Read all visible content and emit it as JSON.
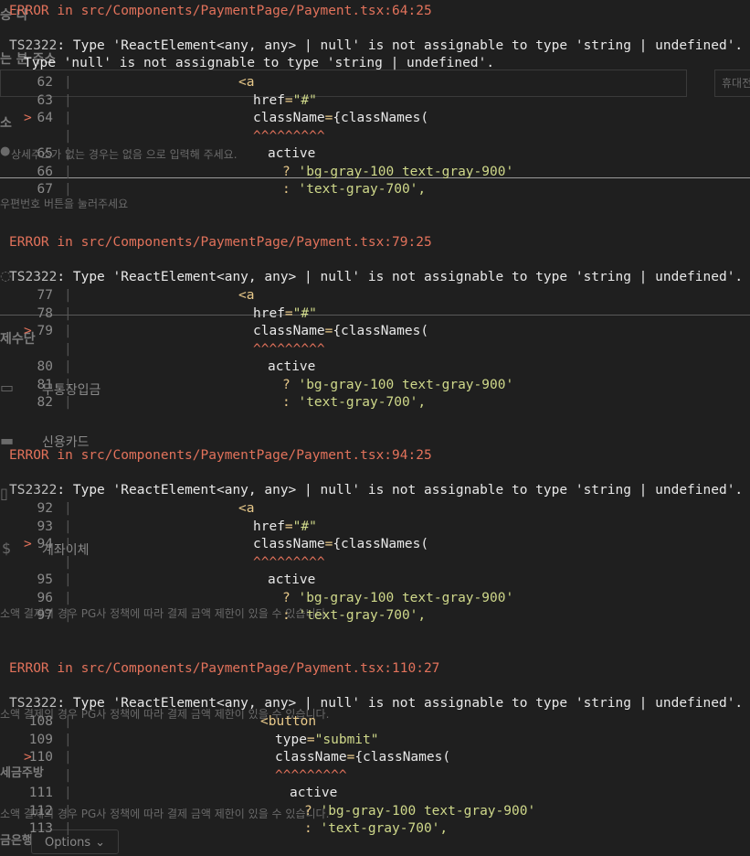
{
  "underlay": {
    "t1": "승 다",
    "t2": "는 분 주소",
    "t3": "소",
    "t4": "상세주소가 없는 경우는 없음 으로 입력해 주세요.",
    "t5": "우편번호 버튼을 눌러주세요",
    "t6": "휴대전",
    "t7": "제수단",
    "t8": "무통장입금",
    "t9": "신용카드",
    "t10": "계좌이체",
    "t11": "소액 결제의 경우 PG사 정책에 따라 결제 금액 제한이 있을 수 있습니다.",
    "t12": "소액 결제의 경우 PG사 정책에 따라 결제 금액 제한이 있을 수 있습니다.",
    "t13": "세금주방",
    "t14": "소액 결제의 경우 PG사 정책에 따라 결제 금액 제한이 있을 수 있습니다.",
    "t15": "금은행",
    "options_label": "Options"
  },
  "errors": [
    {
      "header": "ERROR in src/Components/PaymentPage/Payment.tsx:64:25",
      "code": "TS2322",
      "message": "Type 'ReactElement<any, any> | null' is not assignable to type 'string | undefined'.",
      "submessage": "Type 'null' is not assignable to type 'string | undefined'.",
      "lines": [
        {
          "num": "62",
          "code": "<a"
        },
        {
          "num": "63",
          "code": "href=\"#\""
        },
        {
          "num": "64",
          "code": "className={classNames(",
          "marker": ">"
        },
        {
          "num": "",
          "code": "^^^^^^^^^"
        },
        {
          "num": "65",
          "code": "active"
        },
        {
          "num": "66",
          "code": "? 'bg-gray-100 text-gray-900'"
        },
        {
          "num": "67",
          "code": ": 'text-gray-700',"
        }
      ]
    },
    {
      "header": "ERROR in src/Components/PaymentPage/Payment.tsx:79:25",
      "code": "TS2322",
      "message": "Type 'ReactElement<any, any> | null' is not assignable to type 'string | undefined'.",
      "lines": [
        {
          "num": "77",
          "code": "<a"
        },
        {
          "num": "78",
          "code": "href=\"#\""
        },
        {
          "num": "79",
          "code": "className={classNames(",
          "marker": ">"
        },
        {
          "num": "",
          "code": "^^^^^^^^^"
        },
        {
          "num": "80",
          "code": "active"
        },
        {
          "num": "81",
          "code": "? 'bg-gray-100 text-gray-900'"
        },
        {
          "num": "82",
          "code": ": 'text-gray-700',"
        }
      ]
    },
    {
      "header": "ERROR in src/Components/PaymentPage/Payment.tsx:94:25",
      "code": "TS2322",
      "message": "Type 'ReactElement<any, any> | null' is not assignable to type 'string | undefined'.",
      "lines": [
        {
          "num": "92",
          "code": "<a"
        },
        {
          "num": "93",
          "code": "href=\"#\""
        },
        {
          "num": "94",
          "code": "className={classNames(",
          "marker": ">"
        },
        {
          "num": "",
          "code": "^^^^^^^^^"
        },
        {
          "num": "95",
          "code": "active"
        },
        {
          "num": "96",
          "code": "? 'bg-gray-100 text-gray-900'"
        },
        {
          "num": "97",
          "code": ": 'text-gray-700',"
        }
      ]
    },
    {
      "header": "ERROR in src/Components/PaymentPage/Payment.tsx:110:27",
      "code": "TS2322",
      "message": "Type 'ReactElement<any, any> | null' is not assignable to type 'string | undefined'.",
      "lines": [
        {
          "num": "108",
          "code": "<button"
        },
        {
          "num": "109",
          "code": "type=\"submit\""
        },
        {
          "num": "110",
          "code": "className={classNames(",
          "marker": ">"
        },
        {
          "num": "",
          "code": "^^^^^^^^^"
        },
        {
          "num": "111",
          "code": "active"
        },
        {
          "num": "112",
          "code": "? 'bg-gray-100 text-gray-900'"
        },
        {
          "num": "113",
          "code": ": 'text-gray-700',"
        }
      ]
    }
  ],
  "colors": {
    "background": "#1f1f1f",
    "error": "#e2725b",
    "text": "#e8e8e8",
    "string": "#cfd88a",
    "tag": "#e8c98a"
  }
}
